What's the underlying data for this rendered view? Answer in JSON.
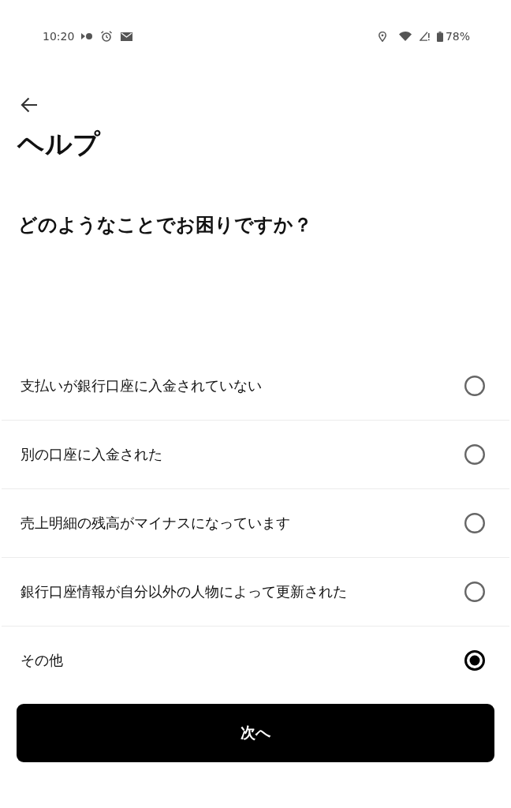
{
  "status_bar": {
    "time": "10:20",
    "battery": "78%"
  },
  "header": {
    "title": "ヘルプ"
  },
  "question": "どのようなことでお困りですか？",
  "options": [
    {
      "label": "支払いが銀行口座に入金されていない",
      "selected": false
    },
    {
      "label": "別の口座に入金された",
      "selected": false
    },
    {
      "label": "売上明細の残高がマイナスになっています",
      "selected": false
    },
    {
      "label": "銀行口座情報が自分以外の人物によって更新された",
      "selected": false
    },
    {
      "label": "その他",
      "selected": true
    }
  ],
  "next_button": {
    "label": "次へ"
  }
}
